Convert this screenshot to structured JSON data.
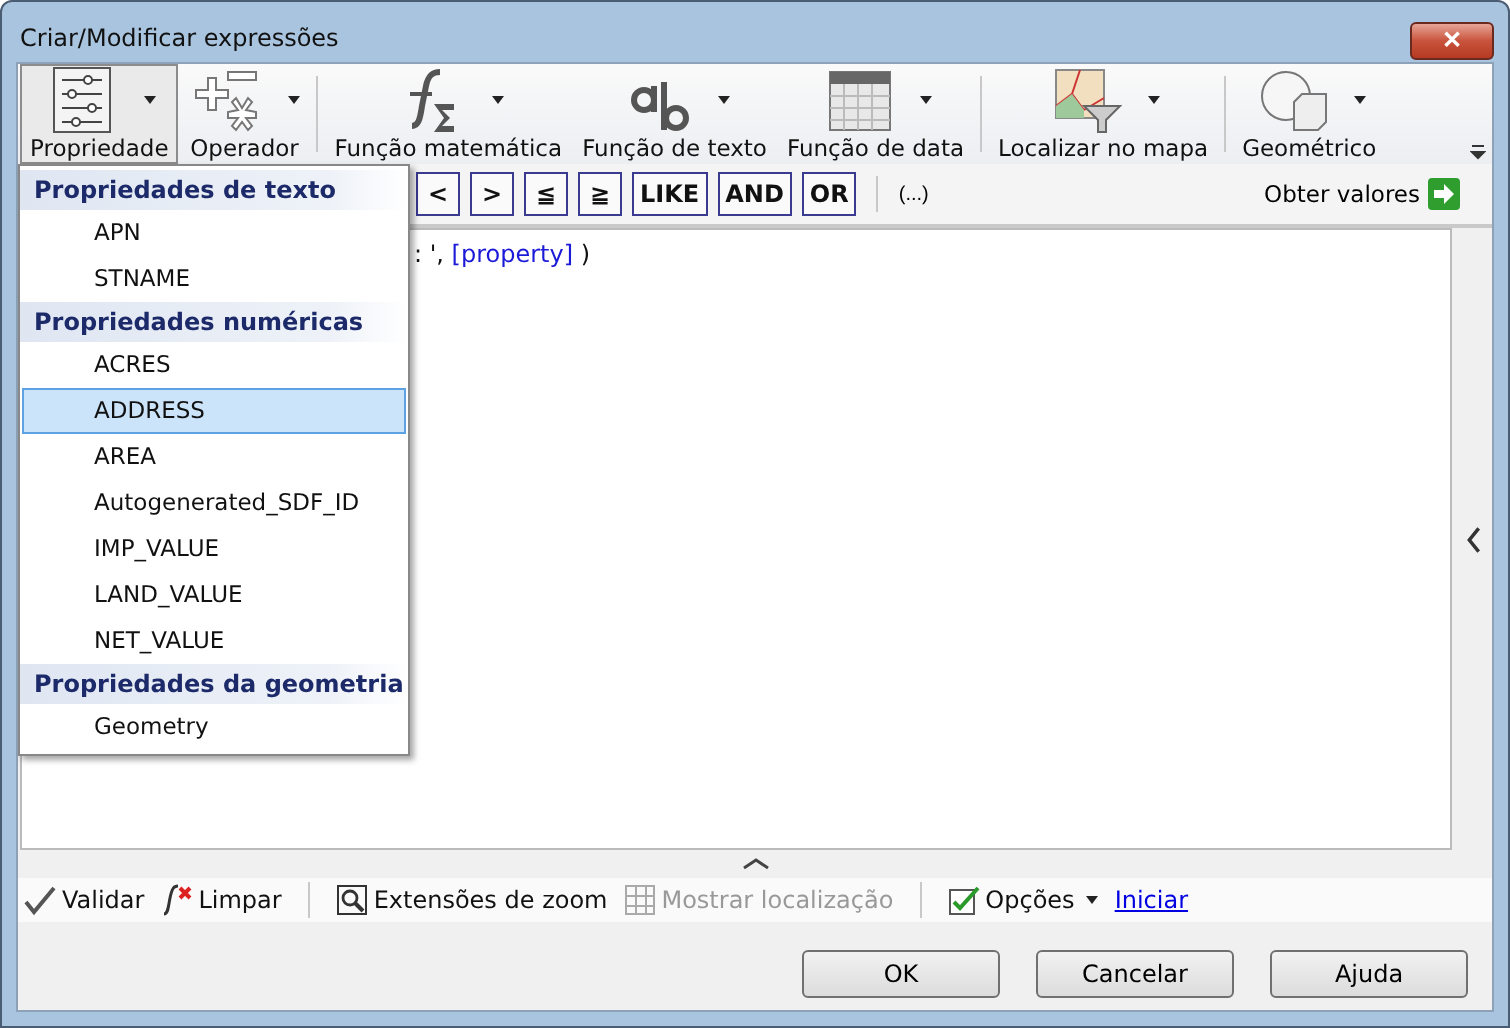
{
  "window": {
    "title": "Criar/Modificar expressões",
    "close_symbol": "✕"
  },
  "ribbon": [
    {
      "label": "Propriedade",
      "kind": "sliders",
      "selected": true
    },
    {
      "label": "Operador",
      "kind": "operator",
      "selected": false
    },
    {
      "label": "Função matemática",
      "kind": "fsigma",
      "selected": false
    },
    {
      "label": "Função de texto",
      "kind": "ab",
      "selected": false
    },
    {
      "label": "Função de data",
      "kind": "calendar",
      "selected": false
    },
    {
      "label": "Localizar no mapa",
      "kind": "mapfilter",
      "selected": false
    },
    {
      "label": "Geométrico",
      "kind": "shapes",
      "selected": false
    }
  ],
  "operators": [
    {
      "label": "<"
    },
    {
      "label": ">"
    },
    {
      "label": "≦"
    },
    {
      "label": "≧"
    },
    {
      "label": "LIKE"
    },
    {
      "label": "AND"
    },
    {
      "label": "OR"
    }
  ],
  "parens": "(...)",
  "get_values": "Obter valores",
  "expression": {
    "text": ": ', ",
    "property": "[property]",
    "close": " )"
  },
  "menu": [
    {
      "heading": "Propriedades de texto",
      "items": [
        {
          "label": "APN",
          "selected": false
        },
        {
          "label": "STNAME",
          "selected": false
        }
      ]
    },
    {
      "heading": "Propriedades numéricas",
      "items": [
        {
          "label": "ACRES",
          "selected": false
        },
        {
          "label": "ADDRESS",
          "selected": true
        },
        {
          "label": "AREA",
          "selected": false
        },
        {
          "label": "Autogenerated_SDF_ID",
          "selected": false
        },
        {
          "label": "IMP_VALUE",
          "selected": false
        },
        {
          "label": "LAND_VALUE",
          "selected": false
        },
        {
          "label": "NET_VALUE",
          "selected": false
        }
      ]
    },
    {
      "heading": "Propriedades da geometria",
      "items": [
        {
          "label": "Geometry",
          "selected": false
        }
      ]
    }
  ],
  "tools": [
    {
      "kind": "validate",
      "label": "Validar",
      "disabled": false
    },
    {
      "kind": "clear",
      "label": "Limpar",
      "disabled": false
    },
    {
      "kind": "zoom",
      "label": "Extensões de zoom",
      "disabled": false
    },
    {
      "kind": "locate",
      "label": "Mostrar localização",
      "disabled": true
    },
    {
      "kind": "options",
      "label": "Opções",
      "disabled": false
    },
    {
      "kind": "link",
      "label": "Iniciar",
      "disabled": false
    }
  ],
  "buttons": [
    "OK",
    "Cancelar",
    "Ajuda"
  ]
}
